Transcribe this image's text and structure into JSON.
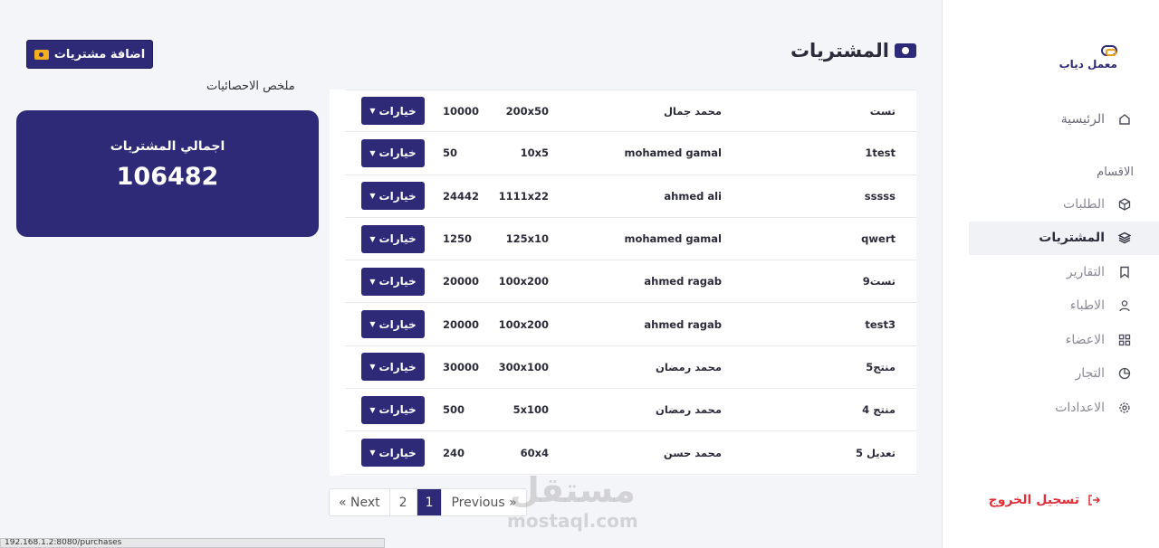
{
  "sidebar": {
    "logo_text": "معمل دياب",
    "home_label": "الرئيسية",
    "section_label": "الاقسام",
    "items": [
      {
        "label": "الطلبات",
        "icon": "box-icon"
      },
      {
        "label": "المشتريات",
        "icon": "layers-icon"
      },
      {
        "label": "التقارير",
        "icon": "bookmark-icon"
      },
      {
        "label": "الاطباء",
        "icon": "user-icon"
      },
      {
        "label": "الاعضاء",
        "icon": "grid-icon"
      },
      {
        "label": "التجار",
        "icon": "pie-chart-icon"
      },
      {
        "label": "الاعدادات",
        "icon": "gear-icon"
      }
    ],
    "logout_label": "تسجيل الخروج"
  },
  "header": {
    "title": "المشتريات"
  },
  "actions": {
    "add_label": "اضافة مشتريات"
  },
  "stats": {
    "label": "ملخص الاحصائيات",
    "card_title": "اجمالي المشتريات",
    "card_value": "106482"
  },
  "table": {
    "options_label": "خيارات",
    "rows": [
      {
        "product": "تست",
        "name": "محمد جمال",
        "qty": "200x50",
        "amount": "10000"
      },
      {
        "product": "1test",
        "name": "mohamed gamal",
        "qty": "10x5",
        "amount": "50"
      },
      {
        "product": "sssss",
        "name": "ahmed ali",
        "qty": "1111x22",
        "amount": "24442"
      },
      {
        "product": "qwert",
        "name": "mohamed gamal",
        "qty": "125x10",
        "amount": "1250"
      },
      {
        "product": "تست9",
        "name": "ahmed ragab",
        "qty": "100x200",
        "amount": "20000"
      },
      {
        "product": "test3",
        "name": "ahmed ragab",
        "qty": "100x200",
        "amount": "20000"
      },
      {
        "product": "منتج5",
        "name": "محمد رمضان",
        "qty": "300x100",
        "amount": "30000"
      },
      {
        "product": "منتج 4",
        "name": "محمد رمضان",
        "qty": "5x100",
        "amount": "500"
      },
      {
        "product": "تعديل 5",
        "name": "محمد حسن",
        "qty": "60x4",
        "amount": "240"
      }
    ]
  },
  "pagination": {
    "next_label": "« Next",
    "pages": [
      "2",
      "1"
    ],
    "active_page": "1",
    "prev_label": "Previous »"
  },
  "watermark": {
    "arabic": "مستقل",
    "latin": "mostaql.com"
  },
  "statusbar": {
    "url": "192.168.1.2:8080/purchases"
  }
}
